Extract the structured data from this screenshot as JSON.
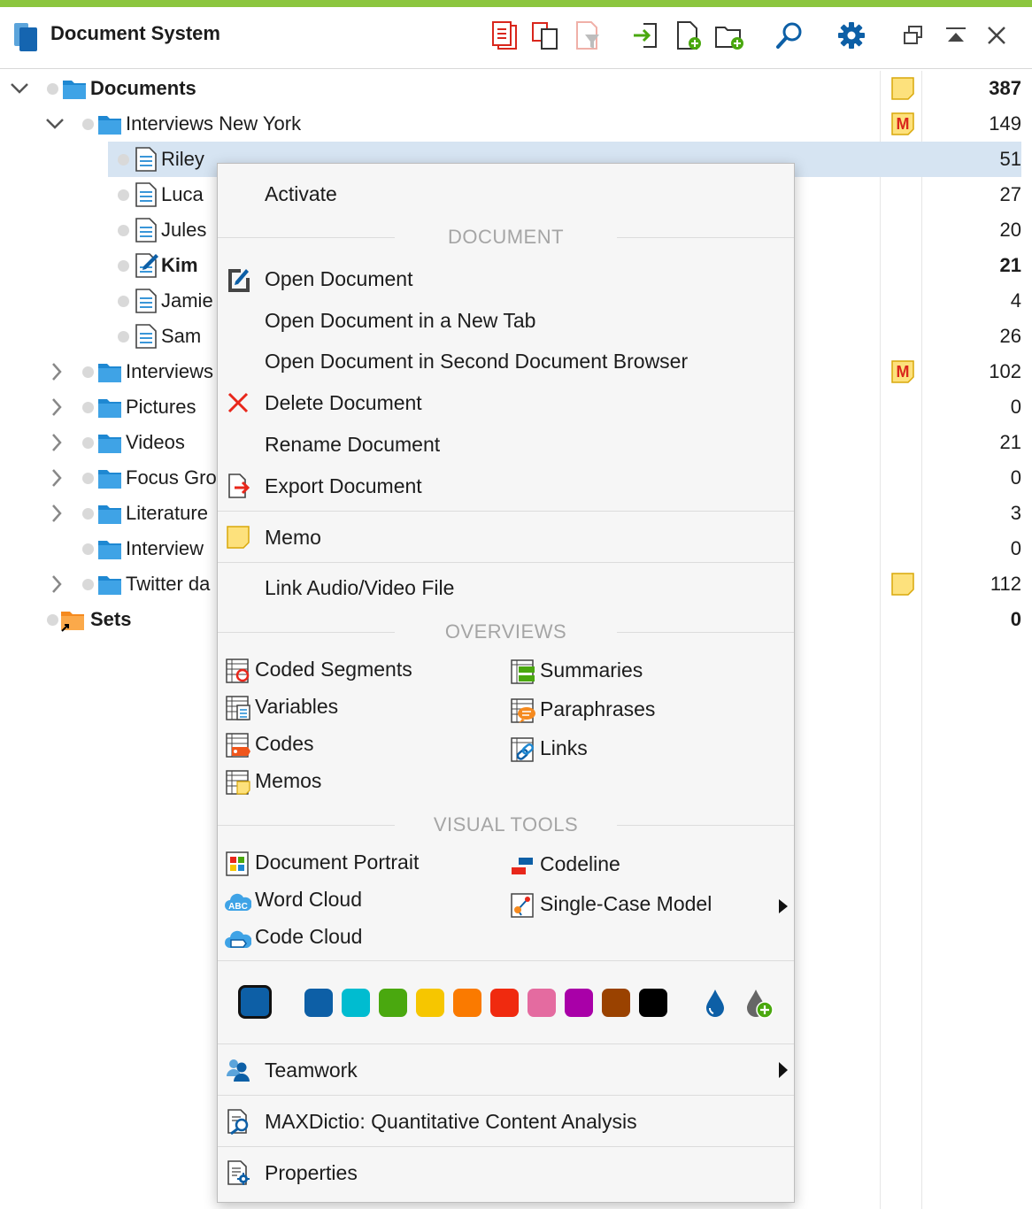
{
  "header": {
    "title": "Document System",
    "toolbar_icons": [
      "activate-docs-icon",
      "copy-docs-icon",
      "filter-docs-icon",
      "import-icon",
      "new-document-icon",
      "new-document-group-icon",
      "search-icon",
      "settings-gear-icon"
    ],
    "window_icons": [
      "undock-window-icon",
      "collapse-window-icon",
      "close-icon"
    ],
    "accent_color": "#8cc63f"
  },
  "tree": {
    "rows": [
      {
        "label": "Documents",
        "count": "387",
        "bold": true,
        "memo": "yellow"
      },
      {
        "label": "Interviews New York",
        "count": "149",
        "memo": "M"
      },
      {
        "label": "Riley",
        "count": "51",
        "selected": true
      },
      {
        "label": "Luca",
        "count": "27"
      },
      {
        "label": "Jules",
        "count": "20"
      },
      {
        "label": "Kim",
        "count": "21",
        "bold": true
      },
      {
        "label": "Jamie",
        "count": "4"
      },
      {
        "label": "Sam",
        "count": "26"
      },
      {
        "label": "Interviews",
        "count": "102",
        "memo": "M"
      },
      {
        "label": "Pictures",
        "count": "0"
      },
      {
        "label": "Videos",
        "count": "21"
      },
      {
        "label": "Focus Gro",
        "count": "0"
      },
      {
        "label": "Literature",
        "count": "3"
      },
      {
        "label": "Interview",
        "count": "0"
      },
      {
        "label": "Twitter da",
        "count": "112",
        "memo": "yellow"
      },
      {
        "label": "Sets",
        "count": "0",
        "bold": true
      }
    ]
  },
  "menu": {
    "activate": "Activate",
    "section_document": "DOCUMENT",
    "open_document": "Open Document",
    "open_new_tab": "Open Document in a New Tab",
    "open_second_browser": "Open Document in Second Document Browser",
    "delete_document": "Delete Document",
    "rename_document": "Rename Document",
    "export_document": "Export Document",
    "memo": "Memo",
    "link_av": "Link Audio/Video File",
    "section_overviews": "OVERVIEWS",
    "overviews_left": [
      "Coded Segments",
      "Variables",
      "Codes",
      "Memos"
    ],
    "overviews_right": [
      "Summaries",
      "Paraphrases",
      "Links"
    ],
    "section_visual": "VISUAL TOOLS",
    "visual_left": [
      "Document Portrait",
      "Word Cloud",
      "Code Cloud"
    ],
    "visual_right": [
      "Codeline",
      "Single-Case Model"
    ],
    "colors": {
      "selected": "#0d5fa6",
      "palette": [
        "#0d5fa6",
        "#00bcd0",
        "#4aa80f",
        "#f6c600",
        "#fa7a00",
        "#f02a0f",
        "#e46ba0",
        "#a900a8",
        "#9a4200",
        "#000000"
      ],
      "icons": [
        "custom-color-drop-icon",
        "add-color-icon"
      ]
    },
    "teamwork": "Teamwork",
    "maxdictio": "MAXDictio: Quantitative Content Analysis",
    "properties": "Properties"
  }
}
